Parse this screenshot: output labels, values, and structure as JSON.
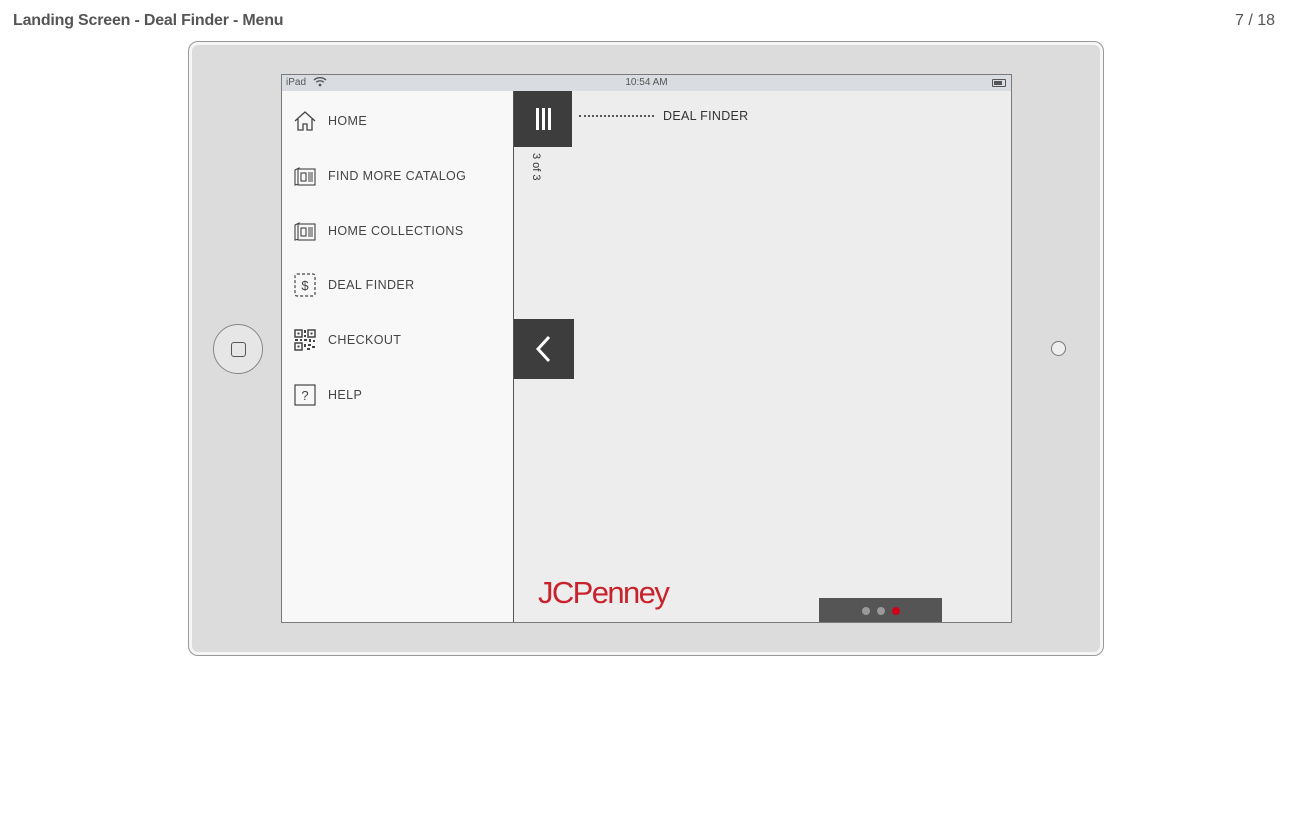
{
  "header": {
    "title": "Landing Screen - Deal Finder - Menu",
    "counter": "7 / 18"
  },
  "statusbar": {
    "carrier": "iPad",
    "time": "10:54 AM"
  },
  "menu": {
    "items": [
      {
        "label": "HOME",
        "icon": "house-icon"
      },
      {
        "label": "FIND MORE CATALOG",
        "icon": "catalog-icon"
      },
      {
        "label": "HOME COLLECTIONS",
        "icon": "catalog-icon"
      },
      {
        "label": "DEAL FINDER",
        "icon": "dollar-tag-icon"
      },
      {
        "label": "CHECKOUT",
        "icon": "qr-code-icon"
      },
      {
        "label": "HELP",
        "icon": "question-icon"
      }
    ]
  },
  "content": {
    "section_title": "DEAL FINDER",
    "page_indicator": "3 of 3",
    "brand": "JCPenney"
  },
  "pager": {
    "total": 3,
    "active": 3
  },
  "colors": {
    "brand_red": "#c8232c",
    "dark_panel": "#3d3d3d",
    "active_dot": "#d0021b"
  }
}
